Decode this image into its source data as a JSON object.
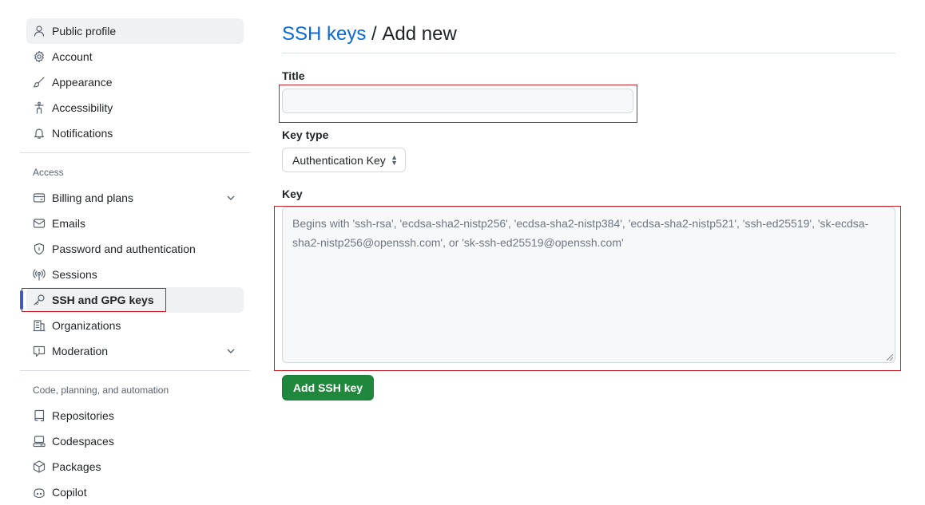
{
  "sidebar": {
    "group1": [
      {
        "label": "Public profile",
        "icon": "person-icon"
      },
      {
        "label": "Account",
        "icon": "gear-icon"
      },
      {
        "label": "Appearance",
        "icon": "paintbrush-icon"
      },
      {
        "label": "Accessibility",
        "icon": "accessibility-icon"
      },
      {
        "label": "Notifications",
        "icon": "bell-icon"
      }
    ],
    "access_heading": "Access",
    "group2": [
      {
        "label": "Billing and plans",
        "icon": "credit-card-icon",
        "expandable": true
      },
      {
        "label": "Emails",
        "icon": "mail-icon"
      },
      {
        "label": "Password and authentication",
        "icon": "shield-lock-icon"
      },
      {
        "label": "Sessions",
        "icon": "broadcast-icon"
      },
      {
        "label": "SSH and GPG keys",
        "icon": "key-icon",
        "active": true
      },
      {
        "label": "Organizations",
        "icon": "organization-icon"
      },
      {
        "label": "Moderation",
        "icon": "report-icon",
        "expandable": true
      }
    ],
    "code_heading": "Code, planning, and automation",
    "group3": [
      {
        "label": "Repositories",
        "icon": "repo-icon"
      },
      {
        "label": "Codespaces",
        "icon": "codespaces-icon"
      },
      {
        "label": "Packages",
        "icon": "package-icon"
      },
      {
        "label": "Copilot",
        "icon": "copilot-icon"
      }
    ]
  },
  "main": {
    "breadcrumb_link": "SSH keys",
    "breadcrumb_sep": " / ",
    "page_title": "Add new",
    "title_label": "Title",
    "title_value": "",
    "key_type_label": "Key type",
    "key_type_value": "Authentication Key",
    "key_label": "Key",
    "key_placeholder": "Begins with 'ssh-rsa', 'ecdsa-sha2-nistp256', 'ecdsa-sha2-nistp384', 'ecdsa-sha2-nistp521', 'ssh-ed25519', 'sk-ecdsa-sha2-nistp256@openssh.com', or 'sk-ssh-ed25519@openssh.com'",
    "submit_label": "Add SSH key"
  },
  "colors": {
    "accent": "#0969da",
    "primary_button": "#1f883d",
    "annotation": "#c8202a"
  }
}
